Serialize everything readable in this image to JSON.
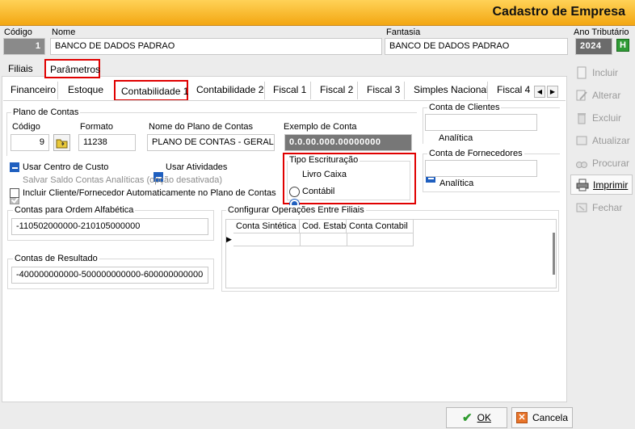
{
  "window": {
    "title": "Cadastro de Empresa"
  },
  "header": {
    "codigo_label": "Código",
    "codigo_value": "1",
    "nome_label": "Nome",
    "nome_value": "BANCO DE DADOS PADRAO",
    "fantasia_label": "Fantasia",
    "fantasia_value": "BANCO DE DADOS PADRAO",
    "ano_label": "Ano Tributário",
    "ano_value": "2024",
    "ano_button": "H"
  },
  "main_tabs": [
    "Filiais",
    "Parâmetros"
  ],
  "sub_tabs": [
    "Financeiro",
    "Estoque",
    "Contabilidade 1",
    "Contabilidade 2",
    "Fiscal 1",
    "Fiscal 2",
    "Fiscal 3",
    "Simples Nacional",
    "Fiscal 4"
  ],
  "plano": {
    "group_label": "Plano de Contas",
    "codigo_label": "Código",
    "codigo_value": "9",
    "formato_label": "Formato",
    "formato_value": "11238",
    "nome_label": "Nome do Plano de Contas",
    "nome_value": "PLANO DE CONTAS - GERAL",
    "exemplo_label": "Exemplo de Conta",
    "exemplo_value": "0.0.00.000.00000000"
  },
  "options": {
    "usar_centro": "Usar Centro de Custo",
    "usar_atividades": "Usar Atividades",
    "salvar_saldo": "Salvar Saldo  Contas Analíticas (opção desativada)",
    "incluir_cliente": "Incluir Cliente/Fornecedor Automaticamente no Plano de Contas"
  },
  "tipo_escrituracao": {
    "label": "Tipo Escrituração",
    "options": [
      "Livro Caixa",
      "Contábil"
    ],
    "selected": "Livro Caixa"
  },
  "conta_clientes": {
    "label": "Conta de Clientes",
    "value": "",
    "analitica": "Analítica"
  },
  "conta_fornecedores": {
    "label": "Conta de Fornecedores",
    "value": "",
    "analitica": "Analítica"
  },
  "ordem_alfabetica": {
    "label": "Contas para Ordem  Alfabética",
    "value": "-110502000000-210105000000"
  },
  "contas_resultado": {
    "label": "Contas de Resultado",
    "value": "-400000000000-500000000000-600000000000"
  },
  "operacoes": {
    "label": "Configurar Operações Entre Filiais",
    "columns": [
      "Conta Sintética",
      "Cod. Estab",
      "Conta Contabil"
    ]
  },
  "side_buttons": [
    {
      "label": "Incluir",
      "icon": "new-document-icon",
      "enabled": false
    },
    {
      "label": "Alterar",
      "icon": "edit-icon",
      "enabled": false
    },
    {
      "label": "Excluir",
      "icon": "trash-icon",
      "enabled": false
    },
    {
      "label": "Atualizar",
      "icon": "refresh-icon",
      "enabled": false
    },
    {
      "label": "Procurar",
      "icon": "binoculars-icon",
      "enabled": false
    },
    {
      "label": "Imprimir",
      "icon": "printer-icon",
      "enabled": true
    },
    {
      "label": "Fechar",
      "icon": "close-door-icon",
      "enabled": false
    }
  ],
  "footer": {
    "ok": "OK",
    "cancel": "Cancela"
  },
  "colors": {
    "accent": "#1f5fbf",
    "titlebar": "#f3a712",
    "highlight": "#e00000"
  }
}
